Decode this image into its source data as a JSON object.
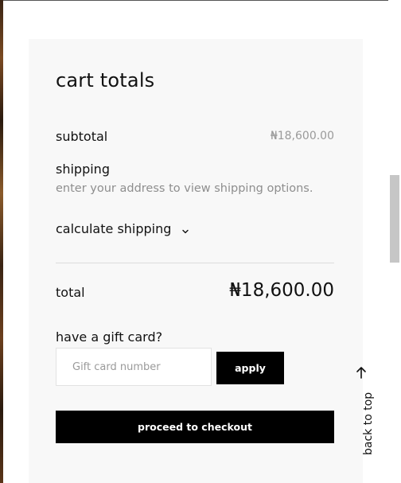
{
  "cart": {
    "title": "cart totals",
    "subtotal_label": "subtotal",
    "subtotal_value": "₦18,600.00",
    "shipping_label": "shipping",
    "shipping_note": "enter your address to view shipping options.",
    "calculate_shipping_label": "calculate shipping",
    "total_label": "total",
    "total_value": "₦18,600.00"
  },
  "gift": {
    "label": "have a gift card?",
    "input_placeholder": "Gift card number",
    "input_value": "",
    "apply_label": "apply"
  },
  "checkout": {
    "label": "proceed to checkout"
  },
  "back_to_top": {
    "label": "back to top"
  },
  "icons": {
    "dropdown": "chevron-down-icon",
    "back_to_top": "arrow-up-icon"
  },
  "colors": {
    "panel_bg": "#f8f8f8",
    "button_bg": "#000000",
    "button_text": "#ffffff",
    "muted_text": "#8e8e8e"
  }
}
